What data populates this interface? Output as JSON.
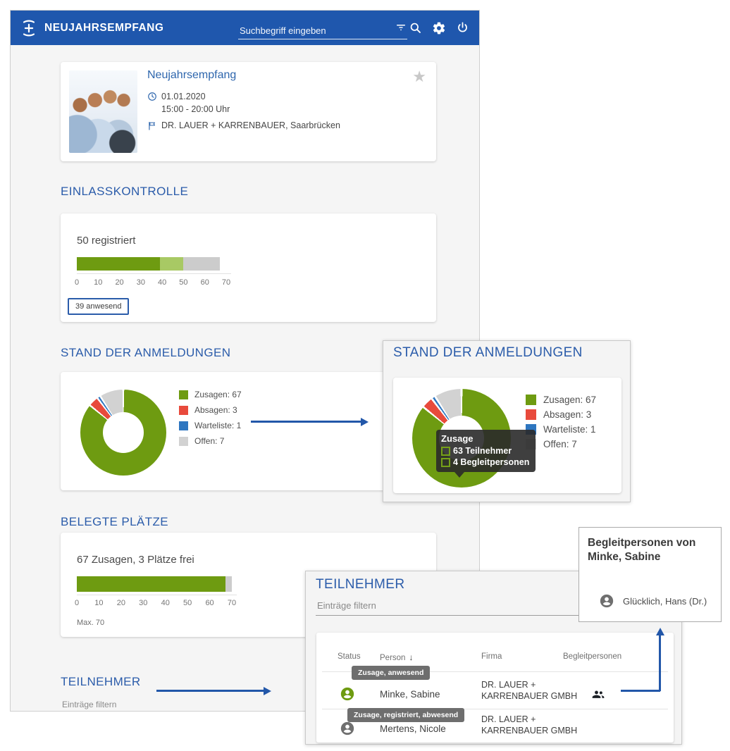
{
  "app": {
    "title": "NEUJAHRSEMPFANG",
    "search_placeholder": "Suchbegriff eingeben"
  },
  "event_card": {
    "title": "Neujahrsempfang",
    "date": "01.01.2020",
    "time": "15:00 - 20:00 Uhr",
    "location": "DR. LAUER + KARRENBAUER, Saarbrücken"
  },
  "sections": {
    "einlass": "EINLASSKONTROLLE",
    "anmeldungen": "STAND DER ANMELDUNGEN",
    "belegte": "BELEGTE PLÄTZE",
    "teilnehmer": "TEILNEHMER"
  },
  "chart_data": [
    {
      "id": "einlasskontrolle",
      "type": "bar",
      "orientation": "horizontal-stacked",
      "label": "50 registriert",
      "badge": "39 anwesend",
      "segments": [
        {
          "name": "anwesend",
          "value": 39,
          "color": "#6e9b11"
        },
        {
          "name": "registriert",
          "value": 11,
          "color": "#a8c964"
        },
        {
          "name": "zusagen",
          "value": 17,
          "color": "#cccccc"
        }
      ],
      "xlim": [
        0,
        70
      ],
      "ticks": [
        0,
        10,
        20,
        30,
        40,
        50,
        60,
        70
      ]
    },
    {
      "id": "stand_der_anmeldungen",
      "type": "pie",
      "donut": true,
      "categories": [
        "Zusagen",
        "Absagen",
        "Warteliste",
        "Offen"
      ],
      "values": [
        67,
        3,
        1,
        7
      ],
      "colors": [
        "#6e9b11",
        "#e84a3c",
        "#2e76c0",
        "#d2d2d2"
      ],
      "legend": [
        "Zusagen: 67",
        "Absagen: 3",
        "Warteliste: 1",
        "Offen: 7"
      ],
      "legend_position": "right",
      "tooltip": {
        "title": "Zusage",
        "items": [
          "63 Teilnehmer",
          "4 Begleitpersonen"
        ]
      }
    },
    {
      "id": "belegte_plaetze",
      "type": "bar",
      "orientation": "horizontal-stacked",
      "label": "67 Zusagen, 3 Plätze frei",
      "note": "Max. 70",
      "segments": [
        {
          "name": "zusagen",
          "value": 67,
          "color": "#6e9b11"
        },
        {
          "name": "frei",
          "value": 3,
          "color": "#cccccc"
        }
      ],
      "xlim": [
        0,
        70
      ],
      "ticks": [
        0,
        10,
        20,
        30,
        40,
        50,
        60,
        70
      ]
    }
  ],
  "teilnehmer": {
    "filter_placeholder": "Einträge filtern",
    "columns": [
      "Status",
      "Person",
      "Firma",
      "Begleitpersonen"
    ],
    "sort_column": "Person",
    "sort_arrow": "↓",
    "rows": [
      {
        "status_tooltip": "Zusage, anwesend",
        "status_color": "#6e9b11",
        "person": "Minke, Sabine",
        "firma": [
          "DR. LAUER +",
          "KARRENBAUER GMBH"
        ],
        "has_begleitpersonen": true
      },
      {
        "status_tooltip": "Zusage, registriert, abwesend",
        "status_color": "#6f6f6f",
        "person": "Mertens, Nicole",
        "firma": [
          "DR. LAUER +",
          "KARRENBAUER GMBH"
        ],
        "has_begleitpersonen": false
      }
    ]
  },
  "begleit_popup": {
    "title_line1": "Begleitpersonen von",
    "title_line2": "Minke, Sabine",
    "entry": "Glücklich, Hans (Dr.)"
  },
  "misc": {
    "star": "★"
  },
  "colors": {
    "header_bg": "#1f57ad",
    "heading_text": "#2b5caa",
    "link_blue": "#2e66ad",
    "green": "#6e9b11",
    "light_green": "#a8c964",
    "bar_gray": "#cccccc",
    "red": "#e84a3c",
    "waitlist_blue": "#2e76c0",
    "arrow_blue": "#2257a9",
    "dark_tooltip": "#2a2a2a",
    "table_tooltip": "#6e6e6e",
    "tooltip_square_border": "#76a018",
    "star_gray": "#c8c8c8"
  }
}
